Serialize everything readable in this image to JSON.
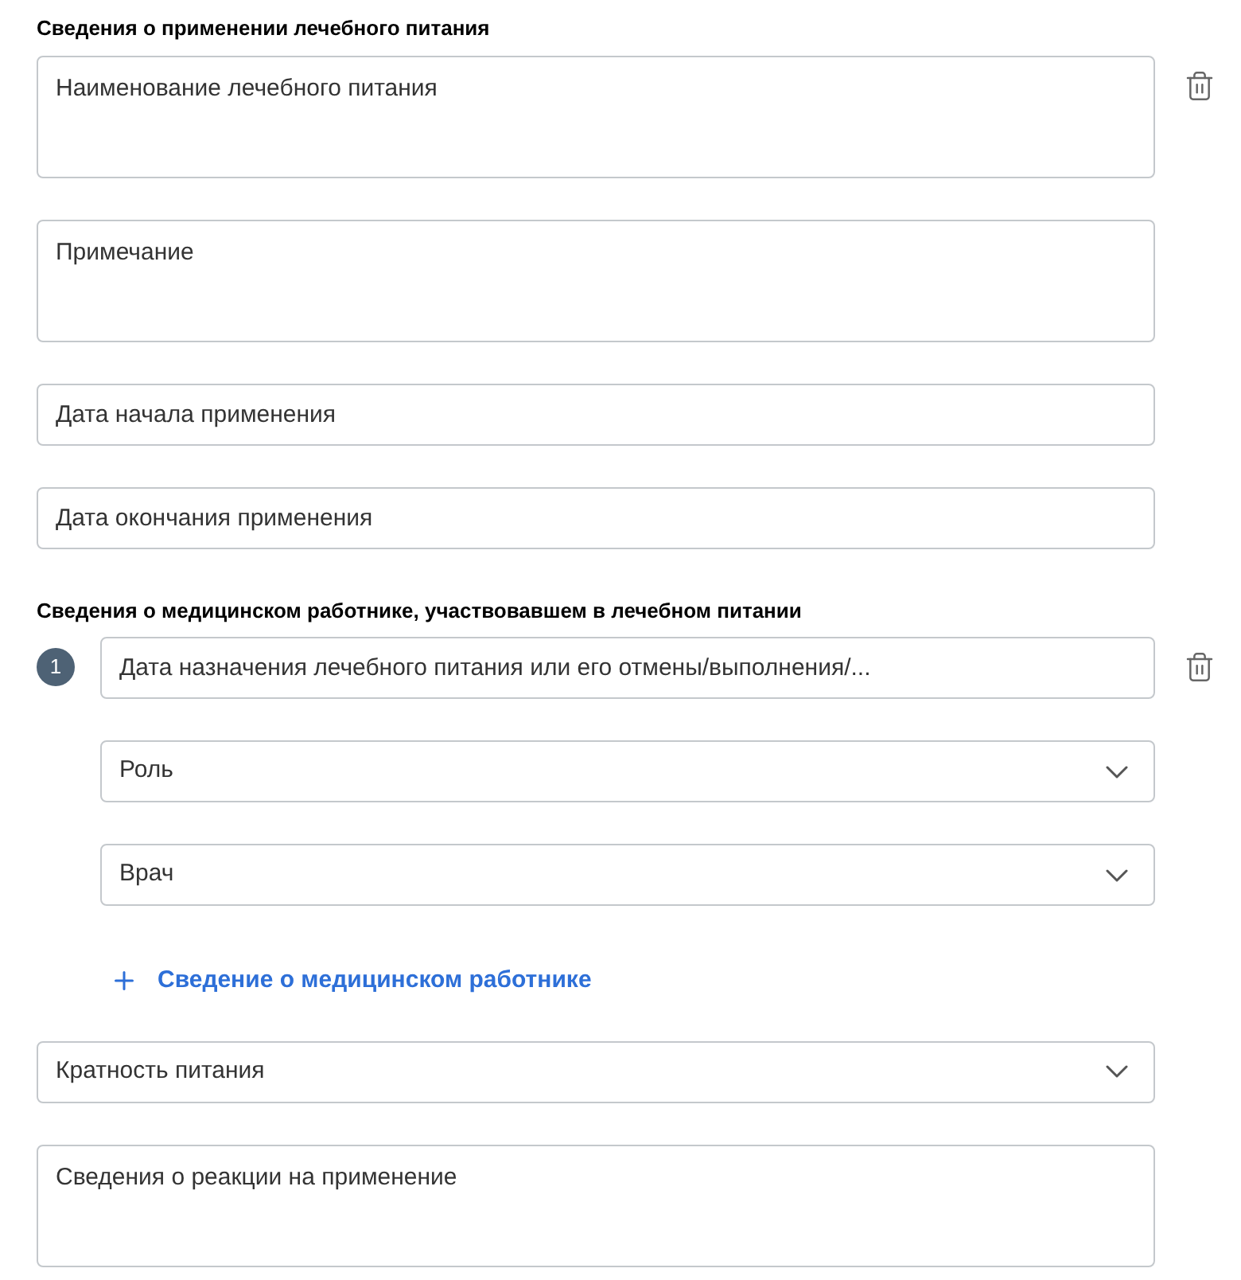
{
  "sections": [
    {
      "title": "Сведения о применении лечебного питания",
      "fields": [
        {
          "kind": "textarea",
          "placeholder": "Наименование лечебного питания",
          "deletable": true
        },
        {
          "kind": "textarea",
          "placeholder": "Примечание",
          "deletable": false
        },
        {
          "kind": "input",
          "placeholder": "Дата начала применения",
          "deletable": false
        },
        {
          "kind": "input",
          "placeholder": "Дата окончания применения",
          "deletable": false
        }
      ]
    },
    {
      "title": "Сведения о медицинском работнике, участвовавшем в лечебном питании",
      "workers": [
        {
          "number": "1",
          "fields": [
            {
              "kind": "input",
              "placeholder": "Дата назначения лечебного питания или его отмены/выполнения/...",
              "deletable": true
            },
            {
              "kind": "select",
              "value": "Роль",
              "deletable": false
            },
            {
              "kind": "select",
              "value": "Врач",
              "deletable": false
            }
          ]
        }
      ],
      "add_link": "Сведение о медицинском работнике",
      "fields": [
        {
          "kind": "select",
          "value": "Кратность питания",
          "deletable": false
        },
        {
          "kind": "textarea",
          "placeholder": "Сведения о реакции на применение",
          "deletable": false
        }
      ]
    }
  ]
}
